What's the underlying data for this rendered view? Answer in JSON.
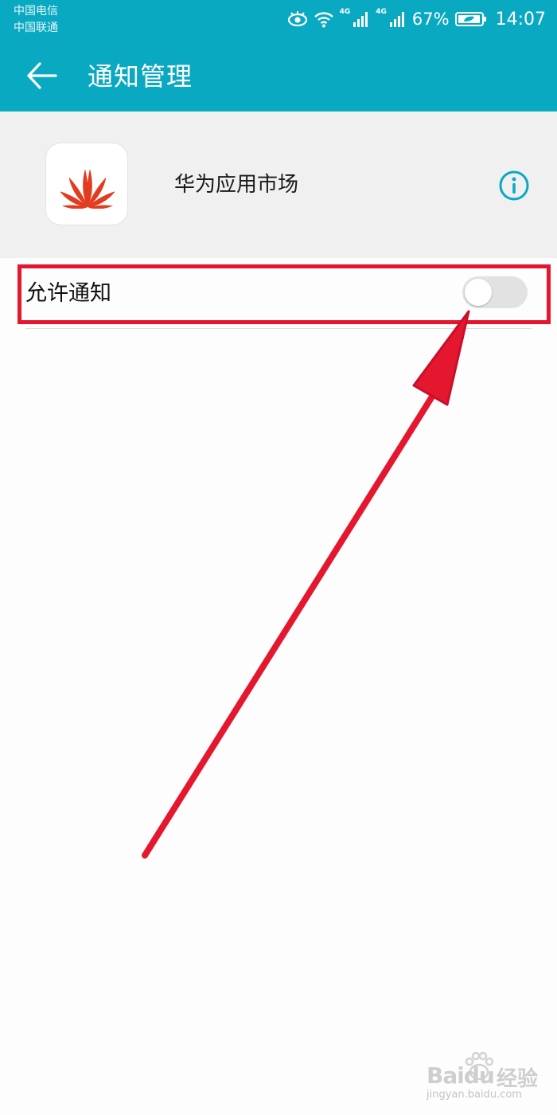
{
  "status_bar": {
    "carrier_1": "中国电信",
    "carrier_2": "中国联通",
    "network_1": "4G",
    "network_2": "4G",
    "battery": "67%",
    "time": "14:07"
  },
  "header": {
    "title": "通知管理",
    "background_color": "#0aa9c2"
  },
  "app": {
    "name": "华为应用市场",
    "icon": "huawei-logo",
    "info_icon": "info-icon"
  },
  "settings": {
    "allow_notifications_label": "允许通知",
    "allow_notifications_enabled": false
  },
  "annotation": {
    "highlight_color": "#e4172f"
  },
  "watermark": {
    "brand": "Baidu",
    "suffix": "经验",
    "url": "jingyan.baidu.com"
  }
}
